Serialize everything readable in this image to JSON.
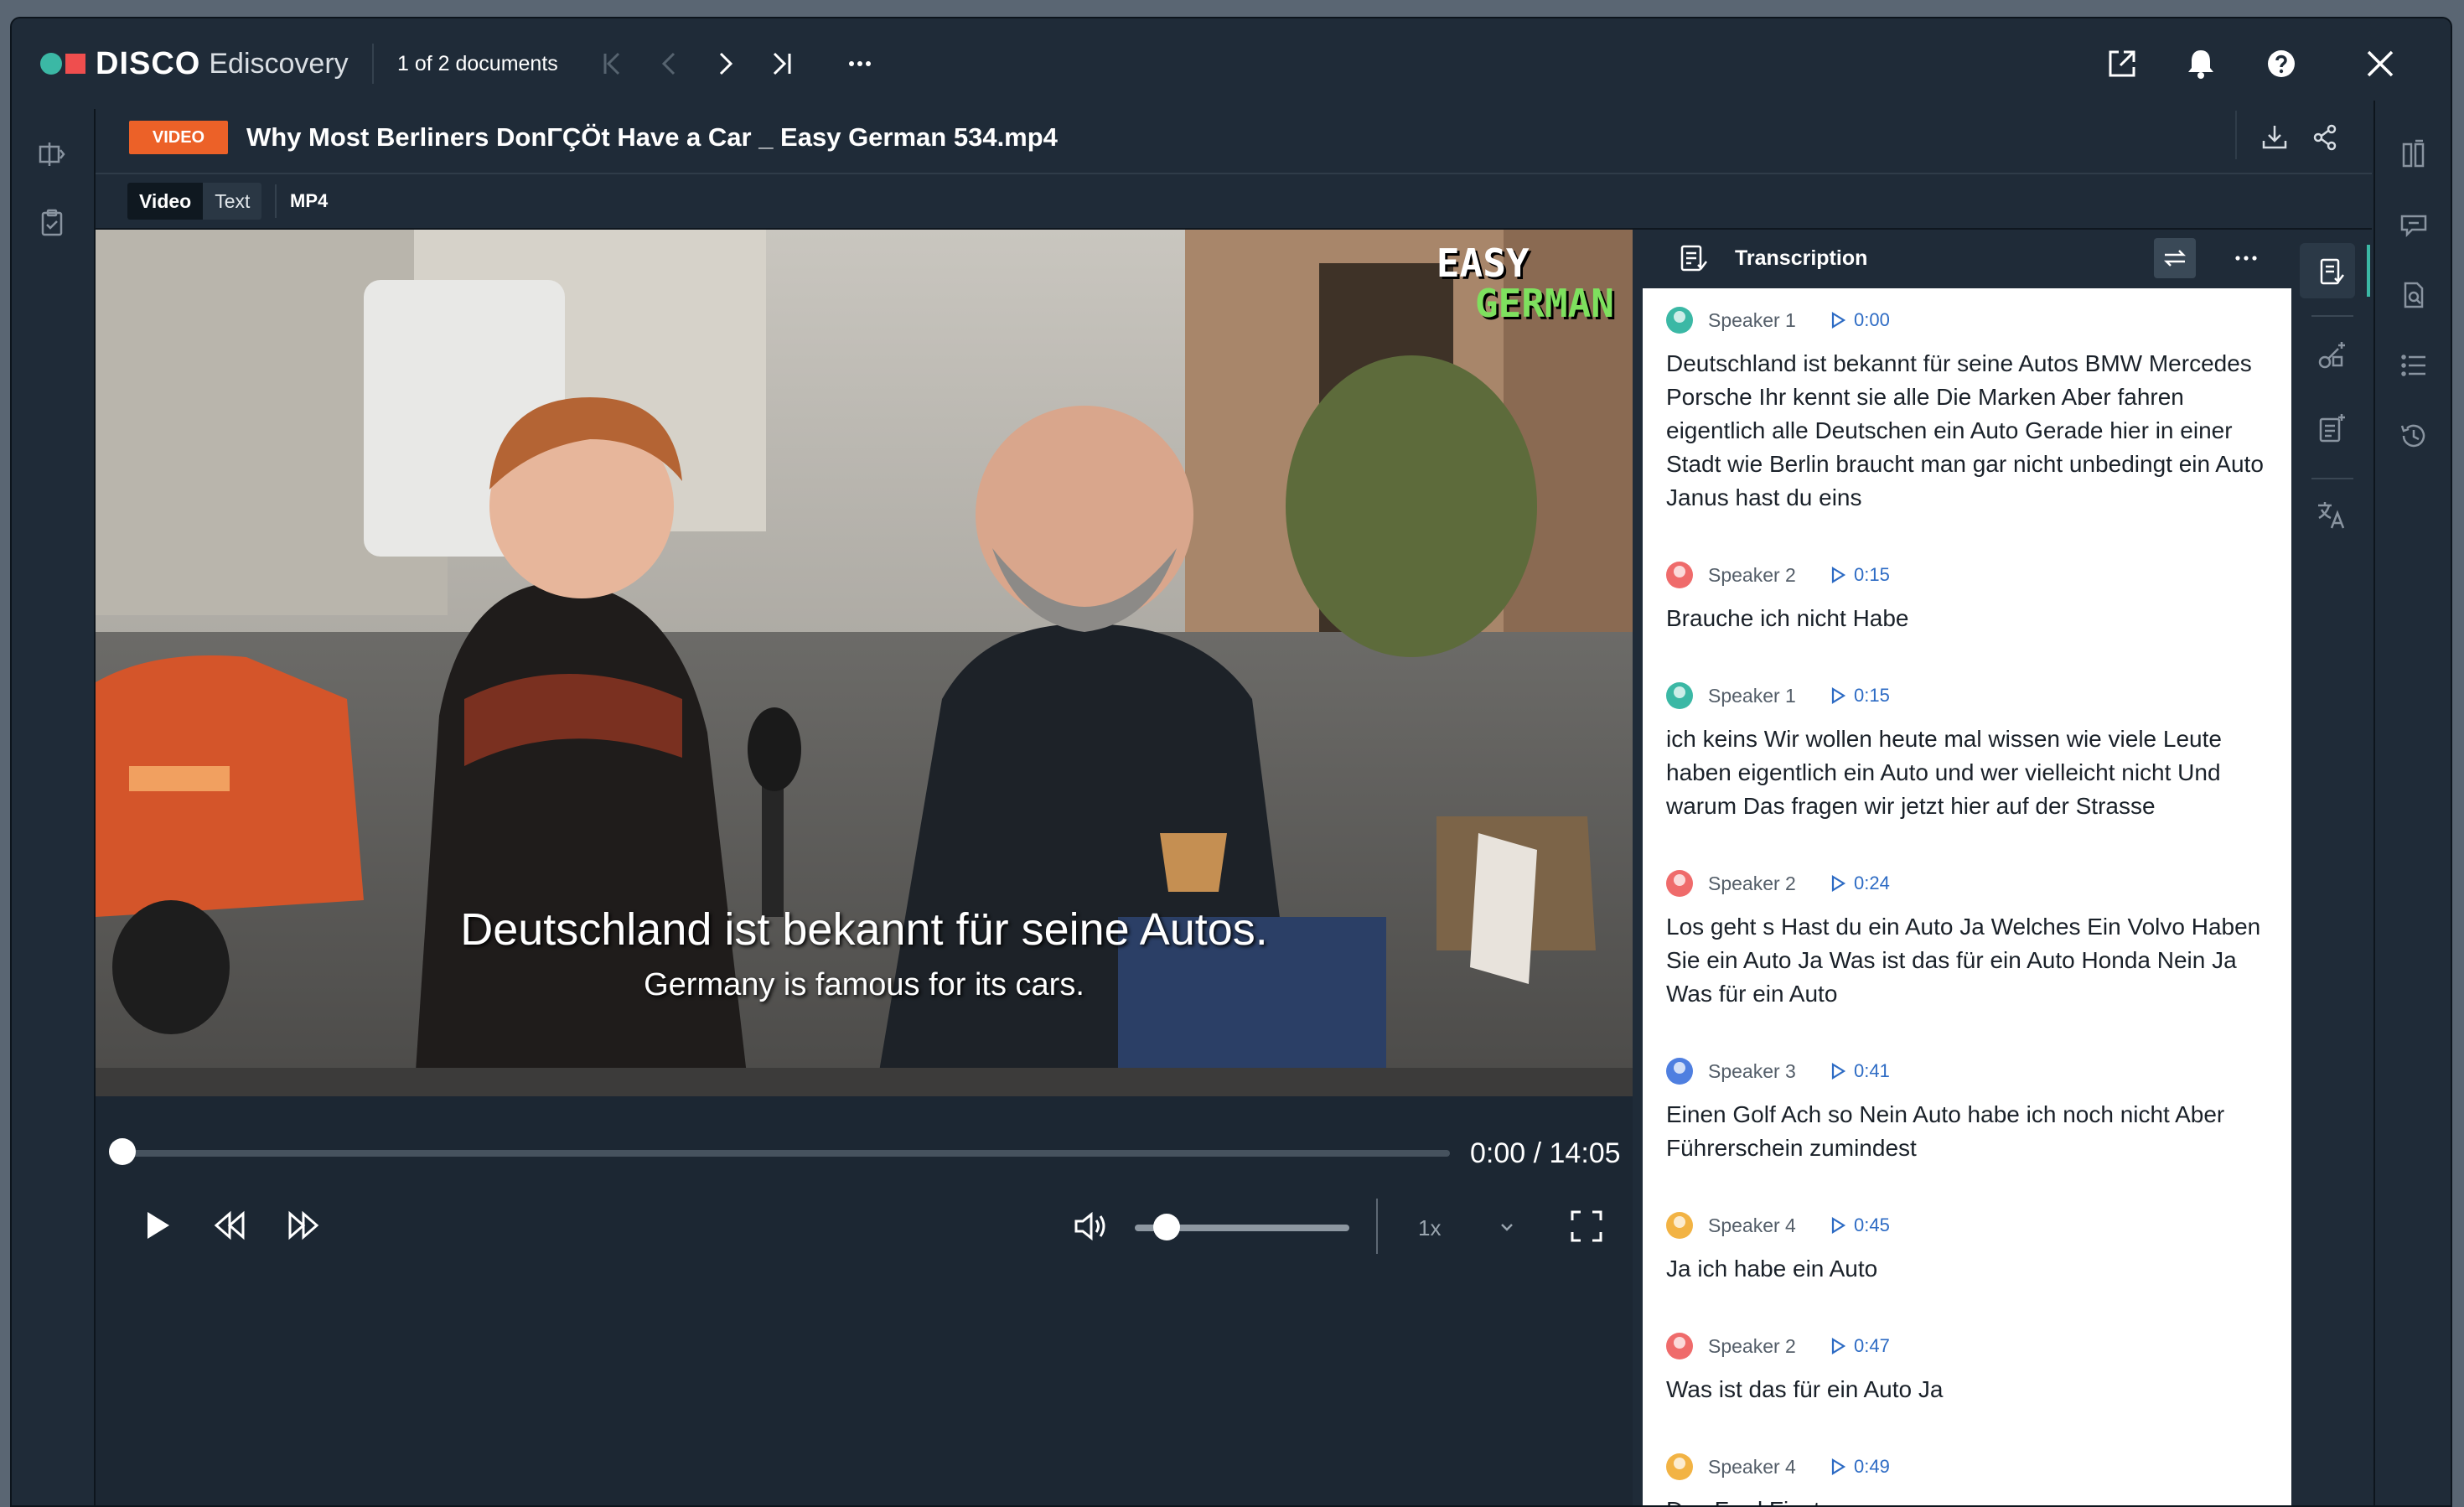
{
  "app": {
    "brand": "DISCO",
    "product": "Ediscovery"
  },
  "nav": {
    "doc_count": "1 of 2 documents"
  },
  "document": {
    "type_badge": "VIDEO",
    "title": "Why Most Berliners DonΓÇÖt Have a Car _ Easy German 534.mp4"
  },
  "tabs": {
    "video": "Video",
    "text": "Text",
    "format": "MP4"
  },
  "video": {
    "logo_line1": "EASY",
    "logo_line2": "GERMAN",
    "subtitle_de": "Deutschland ist bekannt für seine Autos.",
    "subtitle_en": "Germany is famous for its cars.",
    "time": "0:00 / 14:05",
    "progress": 0.0,
    "volume": 0.1,
    "speed": "1x"
  },
  "transcription": {
    "title": "Transcription",
    "segments": [
      {
        "speaker": "Speaker 1",
        "time": "0:00",
        "color": "#3bb8a5",
        "text": "Deutschland ist bekannt für seine Autos BMW Mercedes Porsche Ihr kennt sie alle Die Marken Aber fahren eigentlich alle Deutschen ein Auto Gerade hier in einer Stadt wie Berlin braucht man gar nicht unbedingt ein Auto Janus hast du eins"
      },
      {
        "speaker": "Speaker 2",
        "time": "0:15",
        "color": "#ef6b6b",
        "text": "Brauche ich nicht Habe"
      },
      {
        "speaker": "Speaker 1",
        "time": "0:15",
        "color": "#3bb8a5",
        "text": "ich keins Wir wollen heute mal wissen wie viele Leute haben eigentlich ein Auto und wer vielleicht nicht Und warum Das fragen wir jetzt hier auf der Strasse"
      },
      {
        "speaker": "Speaker 2",
        "time": "0:24",
        "color": "#ef6b6b",
        "text": "Los geht s Hast du ein Auto Ja Welches Ein Volvo Haben Sie ein Auto Ja Was ist das für ein Auto Honda Nein Ja Was für ein Auto"
      },
      {
        "speaker": "Speaker 3",
        "time": "0:41",
        "color": "#4f7fe0",
        "text": "Einen Golf Ach so Nein Auto habe ich noch nicht Aber Führerschein zumindest"
      },
      {
        "speaker": "Speaker 4",
        "time": "0:45",
        "color": "#f2b344",
        "text": "Ja ich habe ein Auto"
      },
      {
        "speaker": "Speaker 2",
        "time": "0:47",
        "color": "#ef6b6b",
        "text": "Was ist das für ein Auto Ja"
      },
      {
        "speaker": "Speaker 4",
        "time": "0:49",
        "color": "#f2b344",
        "text": "Das Ford Fiesta"
      }
    ]
  },
  "icons": {
    "top": [
      "open-external-icon",
      "bell-icon",
      "help-icon",
      "close-icon"
    ],
    "nav": [
      "first-page-icon",
      "previous-icon",
      "next-icon",
      "last-page-icon",
      "more-icon"
    ],
    "header": [
      "download-icon",
      "share-icon"
    ],
    "left_rail": [
      "panel-toggle-icon",
      "clipboard-check-icon"
    ],
    "right_rail": [
      "transcription-icon",
      "annotate-icon",
      "notes-icon",
      "translate-icon"
    ],
    "far_right_rail": [
      "columns-icon",
      "comments-icon",
      "search-doc-icon",
      "list-icon",
      "history-icon"
    ]
  }
}
